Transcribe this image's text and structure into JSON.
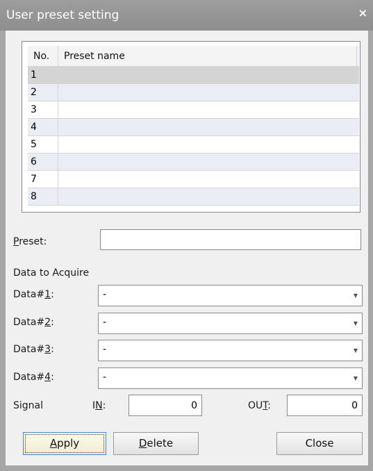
{
  "window": {
    "title": "User preset setting",
    "close_glyph": "×"
  },
  "table": {
    "headers": {
      "no": "No.",
      "name": "Preset name"
    },
    "rows": [
      {
        "no": "1",
        "name": ""
      },
      {
        "no": "2",
        "name": ""
      },
      {
        "no": "3",
        "name": ""
      },
      {
        "no": "4",
        "name": ""
      },
      {
        "no": "5",
        "name": ""
      },
      {
        "no": "6",
        "name": ""
      },
      {
        "no": "7",
        "name": ""
      },
      {
        "no": "8",
        "name": ""
      }
    ]
  },
  "preset": {
    "label_key": "P",
    "label_rest": "reset:",
    "value": ""
  },
  "data_section": {
    "heading": "Data to Acquire",
    "items": [
      {
        "label_pre": "Data#",
        "label_key": "1",
        "label_post": ":",
        "value": "-"
      },
      {
        "label_pre": "Data#",
        "label_key": "2",
        "label_post": ":",
        "value": "-"
      },
      {
        "label_pre": "Data#",
        "label_key": "3",
        "label_post": ":",
        "value": "-"
      },
      {
        "label_pre": "Data#",
        "label_key": "4",
        "label_post": ":",
        "value": "-"
      }
    ]
  },
  "signal": {
    "label": "Signal",
    "in_pre": "I",
    "in_key": "N",
    "in_post": ":",
    "in_value": "0",
    "out_pre": "OU",
    "out_key": "T",
    "out_post": ":",
    "out_value": "0"
  },
  "buttons": {
    "apply_key": "A",
    "apply_rest": "pply",
    "delete_key": "D",
    "delete_rest": "elete",
    "close": "Close"
  },
  "icons": {
    "dropdown": "chevron-down-icon",
    "close": "close-icon"
  }
}
